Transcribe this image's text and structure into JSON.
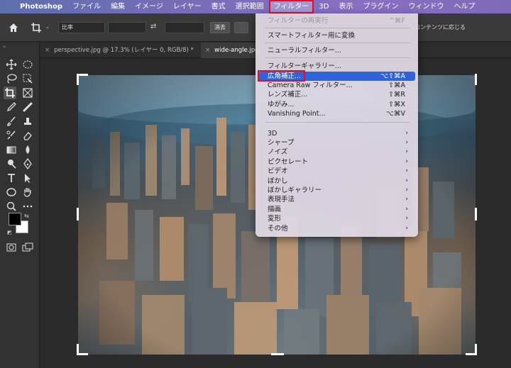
{
  "menubar": {
    "app_name": "Photoshop",
    "items": [
      "ファイル",
      "編集",
      "イメージ",
      "レイヤー",
      "書式",
      "選択範囲",
      "フィルター",
      "3D",
      "表示",
      "プラグイン",
      "ウィンドウ",
      "ヘルプ"
    ],
    "active_item": "フィルター"
  },
  "options_bar": {
    "ratio_label": "比率",
    "clear_label": "消去",
    "trailing_text": "コンテンツに応じる"
  },
  "tabs": [
    {
      "label": "perspective.jpg @ 17.3% (レイヤー 0, RGB/8) *"
    },
    {
      "label": "wide-angle.jpg"
    }
  ],
  "filter_menu": {
    "items": [
      {
        "label": "フィルターの再実行",
        "shortcut": "^⌘F",
        "disabled": true
      },
      {
        "label": "スマートフィルター用に変換",
        "shortcut": ""
      },
      {
        "label": "ニューラルフィルター...",
        "shortcut": ""
      },
      {
        "label": "フィルターギャラリー...",
        "shortcut": ""
      },
      {
        "label": "広角補正...",
        "shortcut": "⌥⇧⌘A",
        "highlighted": true
      },
      {
        "label": "Camera Raw フィルター...",
        "shortcut": "⇧⌘A"
      },
      {
        "label": "レンズ補正...",
        "shortcut": "⇧⌘R"
      },
      {
        "label": "ゆがみ...",
        "shortcut": "⇧⌘X"
      },
      {
        "label": "Vanishing Point...",
        "shortcut": "⌥⌘V"
      },
      {
        "label": "3D",
        "submenu": true
      },
      {
        "label": "シャープ",
        "submenu": true
      },
      {
        "label": "ノイズ",
        "submenu": true
      },
      {
        "label": "ピクセレート",
        "submenu": true
      },
      {
        "label": "ビデオ",
        "submenu": true
      },
      {
        "label": "ぼかし",
        "submenu": true
      },
      {
        "label": "ぼかしギャラリー",
        "submenu": true
      },
      {
        "label": "表現手法",
        "submenu": true
      },
      {
        "label": "描画",
        "submenu": true
      },
      {
        "label": "変形",
        "submenu": true
      },
      {
        "label": "その他",
        "submenu": true
      }
    ],
    "submenu_arrow": "›"
  },
  "colors": {
    "highlight": "#2f64d9",
    "callout": "#e0102a",
    "foreground_swatch": "#000000",
    "background_swatch": "#ffffff"
  }
}
